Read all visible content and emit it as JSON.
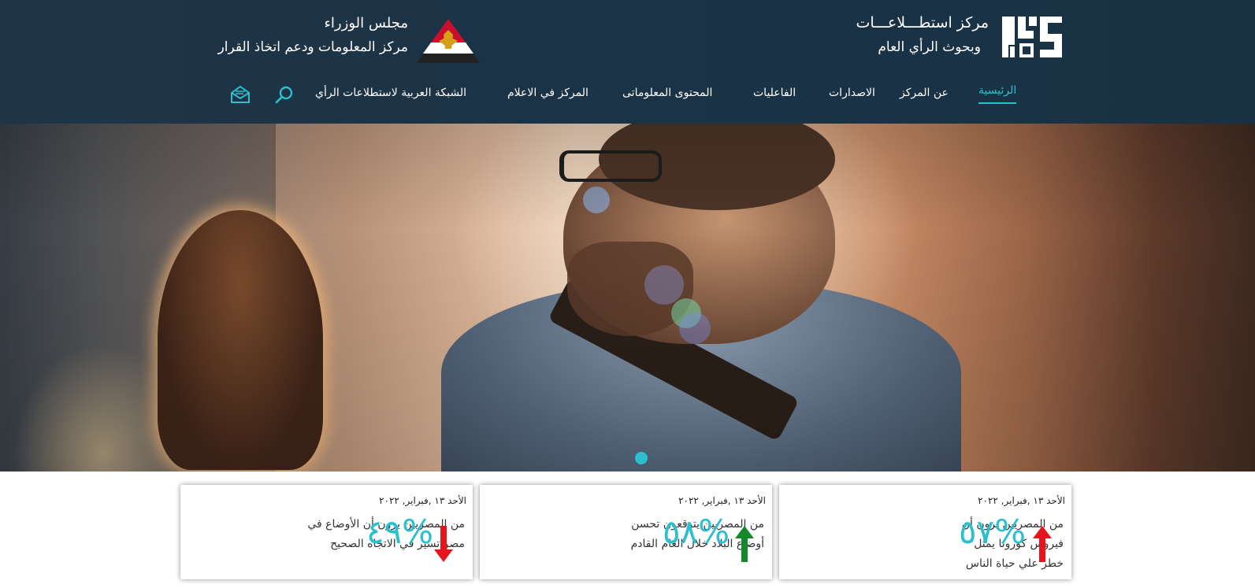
{
  "header": {
    "center_title_line1": "مركز استطـــلاعـــات",
    "center_title_line2": "وبحوث الرأي العام",
    "gov_line1": "مجلس الوزراء",
    "gov_line2": "مركز المعلومات ودعم اتخاذ القرار"
  },
  "nav": {
    "items": [
      {
        "label": "الرئيسية",
        "active": true
      },
      {
        "label": "عن المركز"
      },
      {
        "label": "الاصدارات"
      },
      {
        "label": "الفاعليات"
      },
      {
        "label": "المحتوى المعلوماتى"
      },
      {
        "label": "المركز في الاعلام"
      },
      {
        "label": "الشبكة العربية لاستطلاعات الرأي"
      }
    ],
    "search_icon": "search-icon",
    "mail_icon": "mail-open-icon"
  },
  "colors": {
    "accent": "#2cc0cf",
    "header_bg": "#1c3447",
    "arrow_up_red": "#e8141b",
    "arrow_up_green": "#138a2a",
    "arrow_down_red": "#e8141b"
  },
  "cards": [
    {
      "date": "الأحد ١٣ ,فبراير, ٢٠٢٢",
      "percent": "٥٧%",
      "text": "من المصريين يرون أن فيروس كورونا يمثل خطر علي حياة الناس",
      "trend": "up-red"
    },
    {
      "date": "الأحد ١٣ ,فبراير, ٢٠٢٢",
      "percent": "٥٨%",
      "text": "من المصريين يتوقعون تحسن أوضاع البلاد خلال العام القادم",
      "trend": "up-green"
    },
    {
      "date": "الأحد ١٣ ,فبراير, ٢٠٢٢",
      "percent": "٤٩%",
      "text": "من المصريين يرون أن الأوضاع في مصر تسير في الاتجاه الصحيح",
      "trend": "down-red"
    }
  ]
}
